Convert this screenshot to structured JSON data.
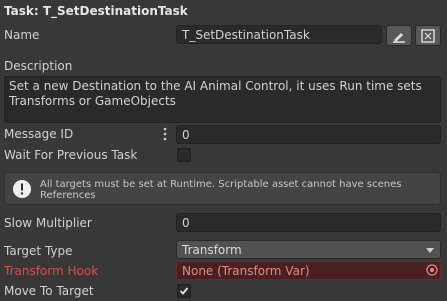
{
  "header": {
    "title": "Task: T_SetDestinationTask"
  },
  "name": {
    "label": "Name",
    "value": "T_SetDestinationTask"
  },
  "description": {
    "label": "Description",
    "value": "Set a new Destination to the AI Animal Control, it uses Run time sets Transforms or GameObjects"
  },
  "message_id": {
    "label": "Message ID",
    "value": "0"
  },
  "wait_for_previous": {
    "label": "Wait For Previous Task",
    "checked": false
  },
  "help": {
    "text": "All targets must be set at Runtime. Scriptable asset cannot have scenes References"
  },
  "slow_multiplier": {
    "label": "Slow Multiplier",
    "value": "0"
  },
  "target_type": {
    "label": "Target Type",
    "value": "Transform"
  },
  "transform_hook": {
    "label": "Transform Hook",
    "value": "None (Transform Var)"
  },
  "move_to_target": {
    "label": "Move To Target",
    "checked": true
  },
  "icons": {
    "edit": "pencil-edit-icon",
    "ping": "reference-icon",
    "menu": "kebab-menu-icon",
    "info": "info-icon",
    "picker": "object-picker-icon",
    "dropdown": "chevron-down-icon",
    "check": "checkmark-icon"
  },
  "colors": {
    "background": "#383838",
    "error_label": "#d84e4e",
    "error_field": "#4a1f1f"
  }
}
